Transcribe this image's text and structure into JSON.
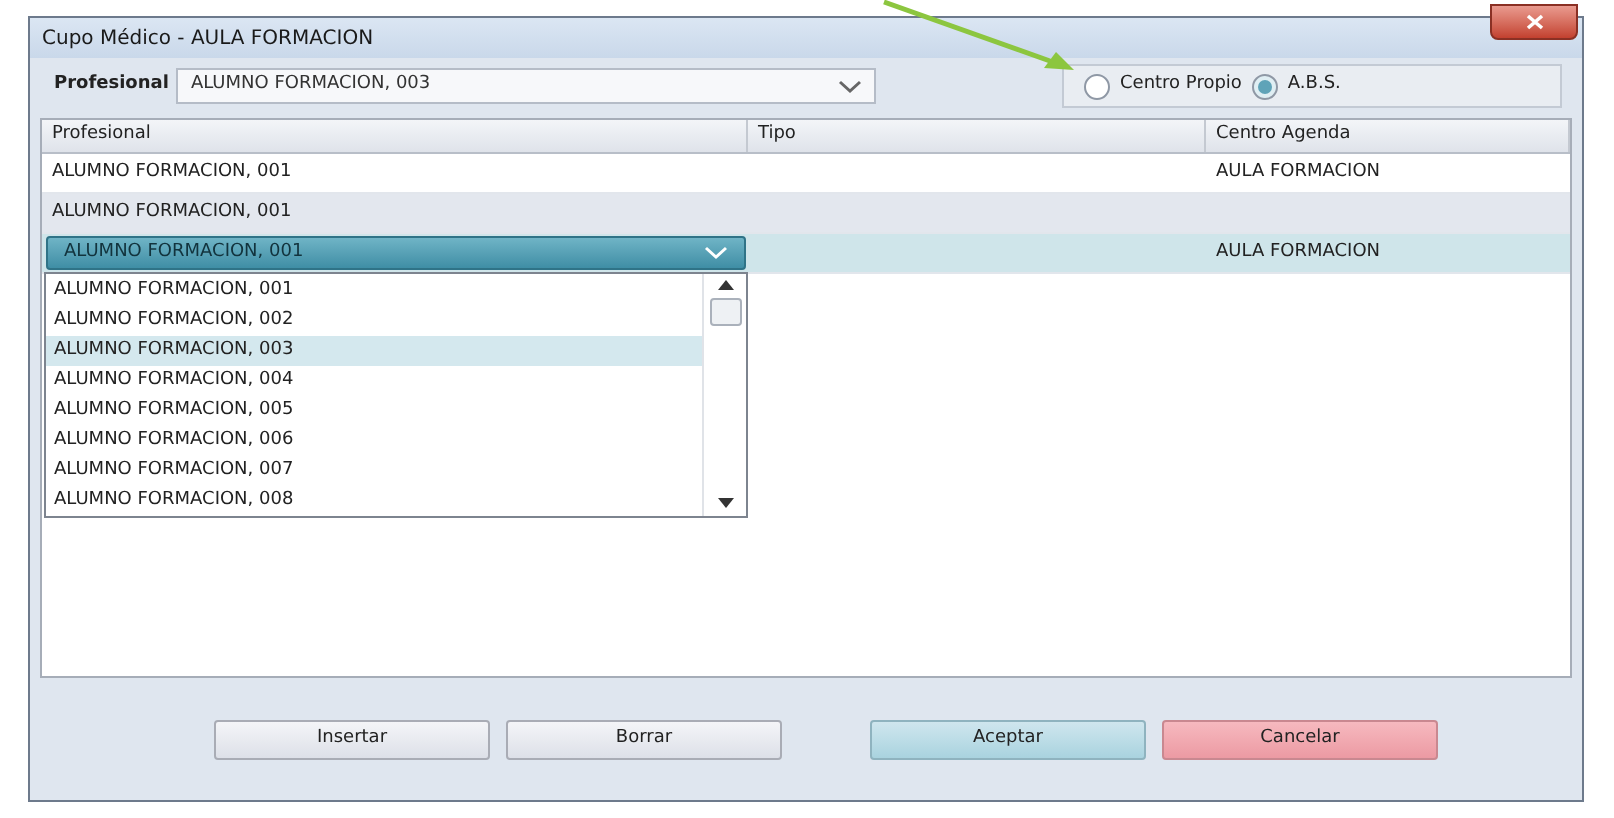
{
  "window": {
    "title": "Cupo Médico - AULA FORMACION"
  },
  "filter": {
    "label": "Profesional",
    "value": "ALUMNO FORMACION, 003"
  },
  "centre_options": [
    {
      "label": "Centro Propio",
      "selected": false
    },
    {
      "label": "A.B.S.",
      "selected": true
    }
  ],
  "table": {
    "columns": [
      "Profesional",
      "Tipo",
      "Centro Agenda"
    ],
    "rows": [
      {
        "cells": [
          "ALUMNO FORMACION, 001",
          "",
          "AULA FORMACION"
        ],
        "selected": false,
        "editing": false
      },
      {
        "cells": [
          "ALUMNO FORMACION, 001",
          "",
          ""
        ],
        "selected": false,
        "editing": false
      },
      {
        "cells": [
          "ALUMNO FORMACION, 001",
          "",
          "AULA FORMACION"
        ],
        "selected": true,
        "editing": true
      }
    ]
  },
  "dropdown": {
    "items": [
      {
        "label": "ALUMNO FORMACION, 001",
        "selected": false
      },
      {
        "label": "ALUMNO FORMACION, 002",
        "selected": false
      },
      {
        "label": "ALUMNO FORMACION, 003",
        "selected": true
      },
      {
        "label": "ALUMNO FORMACION, 004",
        "selected": false
      },
      {
        "label": "ALUMNO FORMACION, 005",
        "selected": false
      },
      {
        "label": "ALUMNO FORMACION, 006",
        "selected": false
      },
      {
        "label": "ALUMNO FORMACION, 007",
        "selected": false
      },
      {
        "label": "ALUMNO FORMACION, 008",
        "selected": false
      }
    ]
  },
  "buttons": [
    {
      "label": "Insertar",
      "kind": "normal"
    },
    {
      "label": "Borrar",
      "kind": "normal"
    },
    {
      "label": "Aceptar",
      "kind": "accept"
    },
    {
      "label": "Cancelar",
      "kind": "cancel"
    }
  ]
}
